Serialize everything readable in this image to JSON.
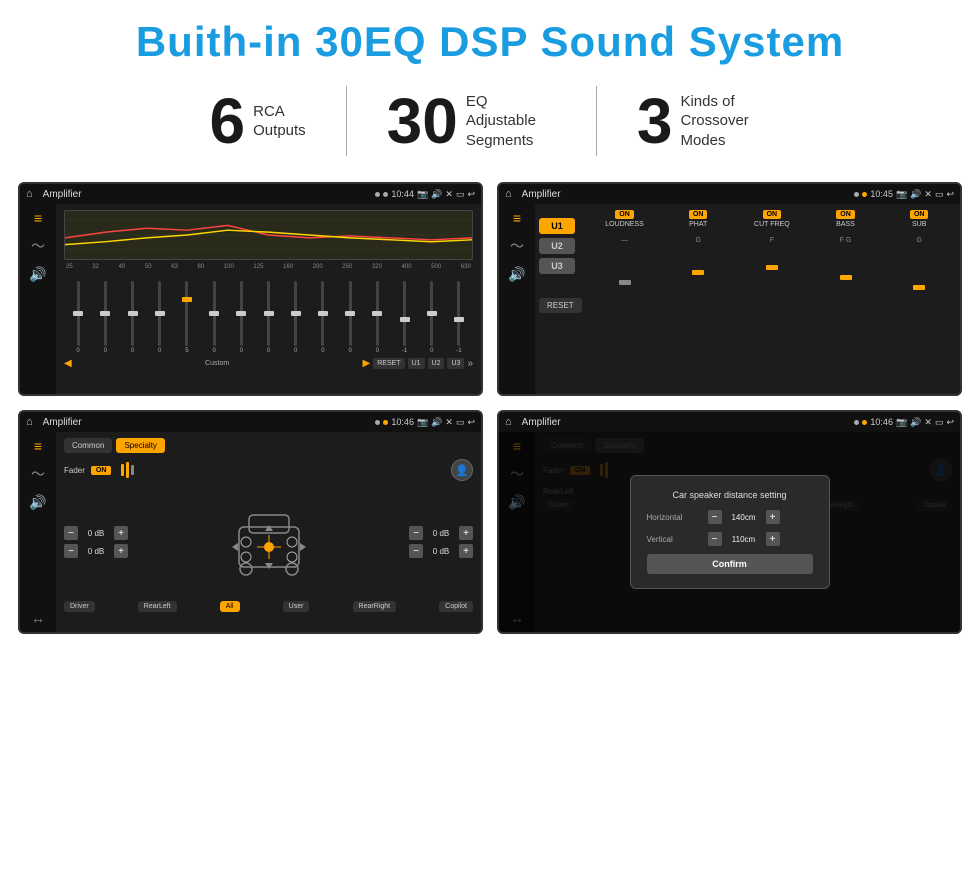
{
  "header": {
    "title": "Buith-in 30EQ DSP Sound System"
  },
  "stats": [
    {
      "number": "6",
      "label": "RCA\nOutputs"
    },
    {
      "number": "30",
      "label": "EQ Adjustable\nSegments"
    },
    {
      "number": "3",
      "label": "Kinds of\nCrossover Modes"
    }
  ],
  "screens": [
    {
      "id": "eq-screen",
      "title": "Amplifier",
      "time": "10:44",
      "type": "equalizer"
    },
    {
      "id": "crossover-screen",
      "title": "Amplifier",
      "time": "10:45",
      "type": "crossover"
    },
    {
      "id": "fader-screen",
      "title": "Amplifier",
      "time": "10:46",
      "type": "fader"
    },
    {
      "id": "dialog-screen",
      "title": "Amplifier",
      "time": "10:46",
      "type": "dialog"
    }
  ],
  "equalizer": {
    "freq_labels": [
      "25",
      "32",
      "40",
      "50",
      "63",
      "80",
      "100",
      "125",
      "160",
      "200",
      "250",
      "320",
      "400",
      "500",
      "630"
    ],
    "slider_values": [
      "0",
      "0",
      "0",
      "0",
      "5",
      "0",
      "0",
      "0",
      "0",
      "0",
      "0",
      "0",
      "-1",
      "0",
      "-1"
    ],
    "preset": "Custom",
    "buttons": [
      "RESET",
      "U1",
      "U2",
      "U3"
    ]
  },
  "crossover": {
    "u_buttons": [
      "U1",
      "U2",
      "U3"
    ],
    "channels": [
      {
        "label": "LOUDNESS",
        "on": true
      },
      {
        "label": "PHAT",
        "on": true
      },
      {
        "label": "CUT FREQ",
        "on": true
      },
      {
        "label": "BASS",
        "on": true
      },
      {
        "label": "SUB",
        "on": true
      }
    ],
    "reset_label": "RESET"
  },
  "fader": {
    "tabs": [
      "Common",
      "Specialty"
    ],
    "active_tab": "Specialty",
    "fader_label": "Fader",
    "on_badge": "ON",
    "db_values": [
      "0 dB",
      "0 dB",
      "0 dB",
      "0 dB"
    ],
    "nav_buttons": [
      "Driver",
      "RearLeft",
      "All",
      "User",
      "RearRight",
      "Copilot"
    ]
  },
  "dialog": {
    "title": "Car speaker distance setting",
    "horizontal_label": "Horizontal",
    "horizontal_value": "140cm",
    "vertical_label": "Vertical",
    "vertical_value": "110cm",
    "confirm_label": "Confirm",
    "fader_label": "Fader",
    "on_badge": "ON"
  }
}
